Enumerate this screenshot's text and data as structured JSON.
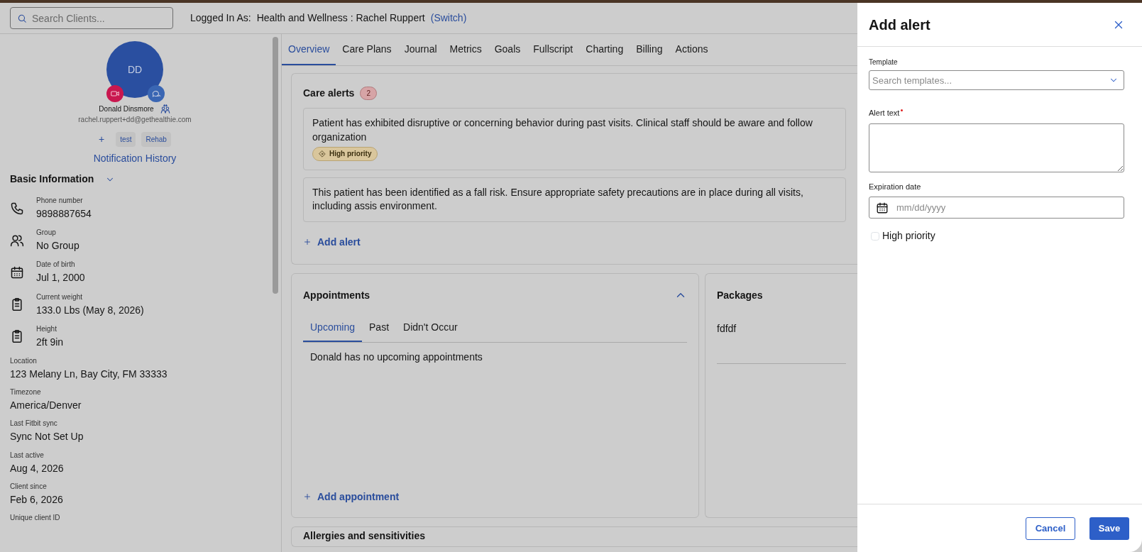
{
  "search": {
    "placeholder": "Search Clients..."
  },
  "logged_in": {
    "label": "Logged In As:",
    "account": "Health and Wellness : Rachel Ruppert",
    "switch_link": "(Switch)"
  },
  "client": {
    "initials": "DD",
    "name": "Donald Dinsmore",
    "email": "rachel.ruppert+dd@gethealthie.com",
    "add_tag": "+",
    "tags": [
      "test",
      "Rehab"
    ],
    "notification_link": "Notification History"
  },
  "basic_info": {
    "title": "Basic Information",
    "expanded": true,
    "icon_fields": [
      {
        "kind": "phone",
        "label": "Phone number",
        "value": "9898887654"
      },
      {
        "kind": "group",
        "label": "Group",
        "value": "No Group"
      },
      {
        "kind": "calendar",
        "label": "Date of birth",
        "value": "Jul 1, 2000"
      },
      {
        "kind": "clipboard",
        "label": "Current weight",
        "value": "133.0 Lbs (May 8, 2026)"
      },
      {
        "kind": "clipboard",
        "label": "Height",
        "value": "2ft 9in"
      }
    ],
    "fields": [
      {
        "label": "Location",
        "value": "123 Melany Ln, Bay City, FM 33333"
      },
      {
        "label": "Timezone",
        "value": "America/Denver"
      },
      {
        "label": "Last Fitbit sync",
        "value": "Sync Not Set Up"
      },
      {
        "label": "Last active",
        "value": "Aug 4, 2026"
      },
      {
        "label": "Client since",
        "value": "Feb 6, 2026"
      },
      {
        "label": "Unique client ID"
      }
    ]
  },
  "tabs": [
    {
      "label": "Overview",
      "selected": true
    },
    {
      "label": "Care Plans",
      "selected": false
    },
    {
      "label": "Journal",
      "selected": false
    },
    {
      "label": "Metrics",
      "selected": false
    },
    {
      "label": "Goals",
      "selected": false
    },
    {
      "label": "Fullscript",
      "selected": false
    },
    {
      "label": "Charting",
      "selected": false
    },
    {
      "label": "Billing",
      "selected": false
    },
    {
      "label": "Actions",
      "selected": false
    }
  ],
  "care_alerts": {
    "title": "Care alerts",
    "count": "2",
    "add_link": "Add alert",
    "alerts": [
      {
        "text": "Patient has exhibited disruptive or concerning behavior during past visits. Clinical staff should be aware and follow organization",
        "high_priority": true,
        "priority_label": "High priority"
      },
      {
        "text": "This patient has been identified as a fall risk. Ensure appropriate safety precautions are in place during all visits, including assis environment.",
        "high_priority": false
      }
    ]
  },
  "appointments": {
    "title": "Appointments",
    "expanded": true,
    "tabs": [
      {
        "label": "Upcoming",
        "selected": true
      },
      {
        "label": "Past",
        "selected": false
      },
      {
        "label": "Didn't Occur",
        "selected": false
      }
    ],
    "empty_message": "Donald has no upcoming appointments",
    "add_link": "Add appointment"
  },
  "packages": {
    "title": "Packages",
    "items": [
      "fdfdf"
    ]
  },
  "allergies": {
    "title": "Allergies and sensitivities"
  },
  "drawer": {
    "title": "Add alert",
    "template": {
      "label": "Template",
      "placeholder": "Search templates..."
    },
    "alert_text": {
      "label": "Alert text",
      "required": true
    },
    "expiration": {
      "label": "Expiration date",
      "placeholder": "mm/dd/yyyy"
    },
    "high_priority": {
      "label": "High priority",
      "checked": false
    },
    "buttons": [
      {
        "label": "Cancel",
        "kind": "secondary"
      },
      {
        "label": "Save",
        "kind": "primary"
      }
    ]
  }
}
